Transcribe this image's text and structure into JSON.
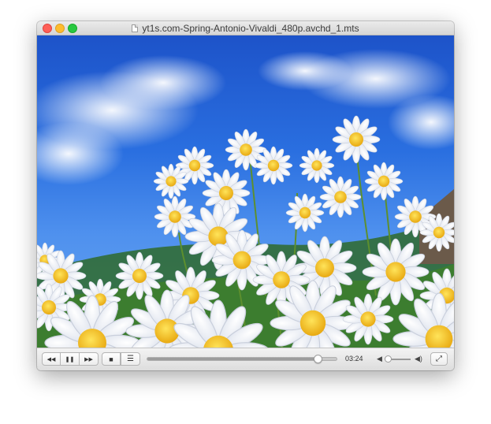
{
  "window": {
    "title": "yt1s.com-Spring-Antonio-Vivaldi_480p.avchd_1.mts"
  },
  "controls": {
    "rewind_icon": "◀◀",
    "pause_icon": "❚❚",
    "forward_icon": "▶▶",
    "stop_icon": "■",
    "playlist_icon": "☰",
    "fullscreen_icon": "⤢",
    "elapsed_time": "03:24",
    "progress_fraction": 0.9,
    "volume_fraction": 0.1,
    "volume_low_icon": "◀",
    "volume_high_icon": "◀)"
  },
  "colors": {
    "close": "#fe5f57",
    "minimize": "#febc2e",
    "maximize": "#28c840"
  }
}
